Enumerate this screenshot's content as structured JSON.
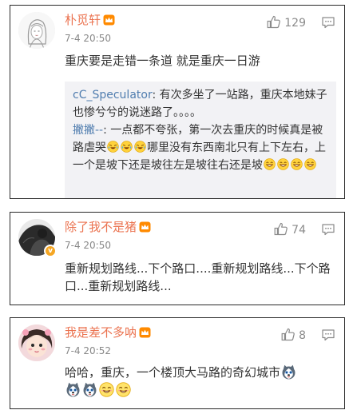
{
  "comments": [
    {
      "username": "朴觅轩",
      "time": "7-4 20:50",
      "likes": "129",
      "text": "重庆要是走错一条道 就是重庆一日游",
      "replies": [
        {
          "user": "cC_Speculator",
          "sep": ": ",
          "text": "有次多坐了一站路，重庆本地妹子也惨兮兮的说迷路了。。。。"
        },
        {
          "user": "撇撇--",
          "sep": ": ",
          "text_a": "一点都不夸张，第一次去重庆的时候真是被路虐哭",
          "text_b": "哪里没有东西南北只有上下左右，上一个是坡下还是坡往左是坡往右还是坡"
        }
      ]
    },
    {
      "username": "除了我不是猪",
      "time": "7-4 20:50",
      "likes": "74",
      "text": "重新规划路线...下个路口....重新规划路线...下个路口...重新规划路线..."
    },
    {
      "username": "我是差不多呐",
      "time": "7-4 20:52",
      "likes": "8",
      "text": "哈哈，重庆，一个楼顶大马路的奇幻城市"
    }
  ],
  "icons": {
    "like": "thumbs-up-icon",
    "comment": "comment-bubble-icon",
    "member": "crown-icon",
    "verified": "verified-badge-icon",
    "emoji_cry": "laugh-cry-emoji",
    "emoji_grin": "grin-emoji",
    "emoji_husky": "husky-emoji",
    "emoji_smile": "smile-emoji"
  },
  "colors": {
    "username": "#eb7350",
    "reply_user": "#507daf",
    "time": "#888888",
    "reply_bg": "#f2f2f5"
  }
}
